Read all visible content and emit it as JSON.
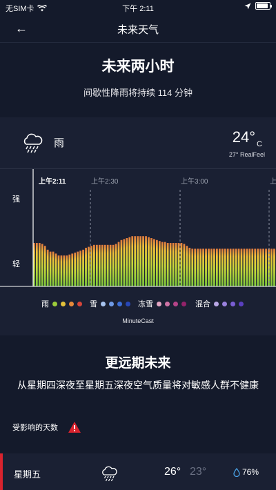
{
  "status": {
    "carrier": "无SIM卡",
    "time": "下午 2:11"
  },
  "nav": {
    "title": "未来天气"
  },
  "section1": {
    "title": "未来两小时",
    "subtitle": "间歇性降雨将持续 114 分钟",
    "condition": "雨",
    "temperature": "24°",
    "unit": "C",
    "realfeel": "27° RealFeel"
  },
  "chart": {
    "ticks": [
      "上午2:11",
      "上午2:30",
      "上午3:00",
      "上"
    ],
    "y_labels": [
      "强",
      "轻"
    ]
  },
  "legend": {
    "groups": [
      {
        "label": "雨",
        "colors": [
          "#9ccc3a",
          "#e3c13a",
          "#e6893a",
          "#d6453a"
        ]
      },
      {
        "label": "雪",
        "colors": [
          "#a8c4f0",
          "#6f9ae6",
          "#3d6fd8",
          "#2747b7"
        ]
      },
      {
        "label": "冻雪",
        "colors": [
          "#e3a6c4",
          "#cf73a6",
          "#b54489",
          "#93226a"
        ]
      },
      {
        "label": "混合",
        "colors": [
          "#b9a7e6",
          "#9a82df",
          "#7a5ed3",
          "#5a3fc0"
        ]
      }
    ],
    "caption": "MinuteCast"
  },
  "section2": {
    "title": "更远期未来",
    "description": "从星期四深夜至星期五深夜空气质量将对敏感人群不健康",
    "affected_label": "受影响的天数"
  },
  "day_row": {
    "day": "星期五",
    "high": "26°",
    "low": "23°",
    "precip": "76%"
  },
  "chart_data": {
    "type": "bar",
    "ylim": [
      0,
      1
    ],
    "values": [
      0.45,
      0.45,
      0.45,
      0.44,
      0.42,
      0.38,
      0.36,
      0.36,
      0.34,
      0.32,
      0.32,
      0.32,
      0.32,
      0.33,
      0.34,
      0.35,
      0.36,
      0.37,
      0.38,
      0.4,
      0.41,
      0.42,
      0.43,
      0.43,
      0.43,
      0.43,
      0.43,
      0.43,
      0.43,
      0.43,
      0.44,
      0.46,
      0.48,
      0.49,
      0.5,
      0.51,
      0.52,
      0.52,
      0.52,
      0.52,
      0.52,
      0.52,
      0.51,
      0.5,
      0.49,
      0.48,
      0.47,
      0.46,
      0.46,
      0.45,
      0.45,
      0.45,
      0.45,
      0.45,
      0.45,
      0.44,
      0.42,
      0.4,
      0.39,
      0.39,
      0.39,
      0.39,
      0.39,
      0.39,
      0.39,
      0.39,
      0.39,
      0.39,
      0.39,
      0.39,
      0.39,
      0.39,
      0.39,
      0.39,
      0.39,
      0.39,
      0.39,
      0.39,
      0.39,
      0.39,
      0.39,
      0.39,
      0.39,
      0.39,
      0.39,
      0.39,
      0.39,
      0.39,
      0.39
    ]
  }
}
